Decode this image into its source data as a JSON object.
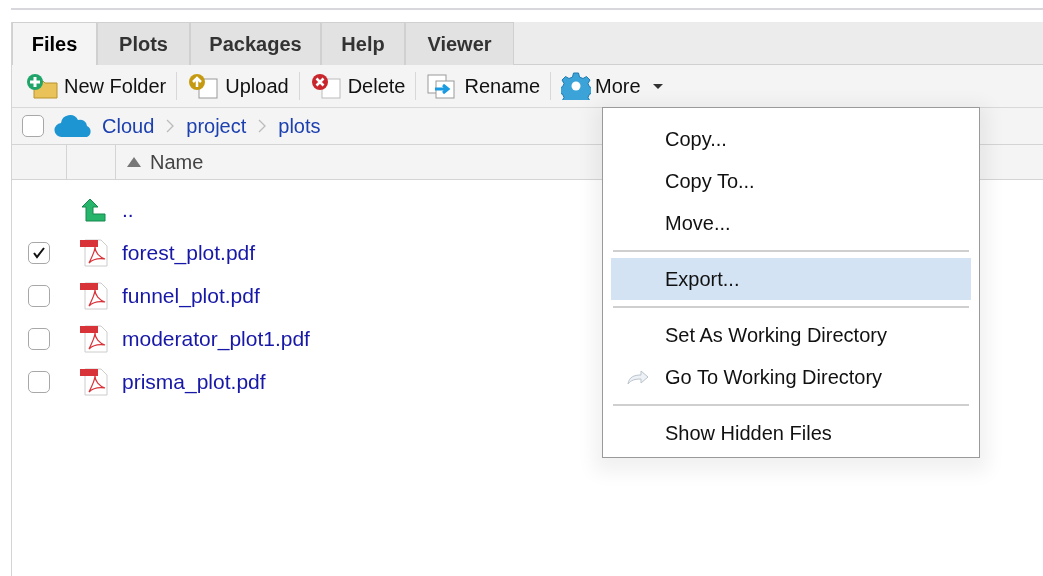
{
  "tabs": [
    {
      "label": "Files",
      "selected": true
    },
    {
      "label": "Plots",
      "selected": false
    },
    {
      "label": "Packages",
      "selected": false
    },
    {
      "label": "Help",
      "selected": false
    },
    {
      "label": "Viewer",
      "selected": false
    }
  ],
  "toolbar": [
    {
      "label": "New Folder",
      "kind": "new_folder"
    },
    {
      "label": "Upload",
      "kind": "upload"
    },
    {
      "label": "Delete",
      "kind": "delete"
    },
    {
      "label": "Rename",
      "kind": "rename"
    },
    {
      "label": "More",
      "kind": "more",
      "expanded": true
    }
  ],
  "breadcrumb": {
    "checked": false,
    "items": [
      "Cloud",
      "project",
      "plots"
    ]
  },
  "table": {
    "columns": [
      "Name"
    ],
    "rows": [
      {
        "name": "..",
        "kind": "parent"
      },
      {
        "name": "forest_plot.pdf",
        "kind": "pdf",
        "checked": true
      },
      {
        "name": "funnel_plot.pdf",
        "kind": "pdf",
        "checked": false
      },
      {
        "name": "moderator_plot1.pdf",
        "kind": "pdf",
        "checked": false
      },
      {
        "name": "prisma_plot.pdf",
        "kind": "pdf",
        "checked": false
      }
    ]
  },
  "menu": [
    {
      "kind": "item",
      "label": "Copy...",
      "selected": false
    },
    {
      "kind": "item",
      "label": "Copy To...",
      "selected": false
    },
    {
      "kind": "item",
      "label": "Move...",
      "selected": false
    },
    {
      "kind": "separator"
    },
    {
      "kind": "item",
      "label": "Export...",
      "selected": true
    },
    {
      "kind": "separator"
    },
    {
      "kind": "item",
      "label": "Set As Working Directory",
      "selected": false
    },
    {
      "kind": "icon_item",
      "label": "Go To Working Directory",
      "selected": false
    },
    {
      "kind": "separator"
    },
    {
      "kind": "item",
      "label": "Show Hidden Files",
      "selected": false
    }
  ]
}
